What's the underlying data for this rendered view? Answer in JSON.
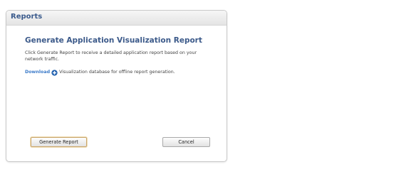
{
  "panel": {
    "title": "Reports"
  },
  "content": {
    "heading": "Generate Application Visualization Report",
    "description": "Click Generate Report to receive a detailed application report based on your network traffic.",
    "download_link": "Download",
    "download_text": " Visualization database for offline report generation."
  },
  "buttons": {
    "generate": "Generate Report",
    "cancel": "Cancel"
  },
  "colors": {
    "title": "#3a5a8c",
    "link": "#3b7ac9",
    "plus_icon": "#1f5fae"
  },
  "icons": {
    "download": "plus-circle-icon"
  }
}
